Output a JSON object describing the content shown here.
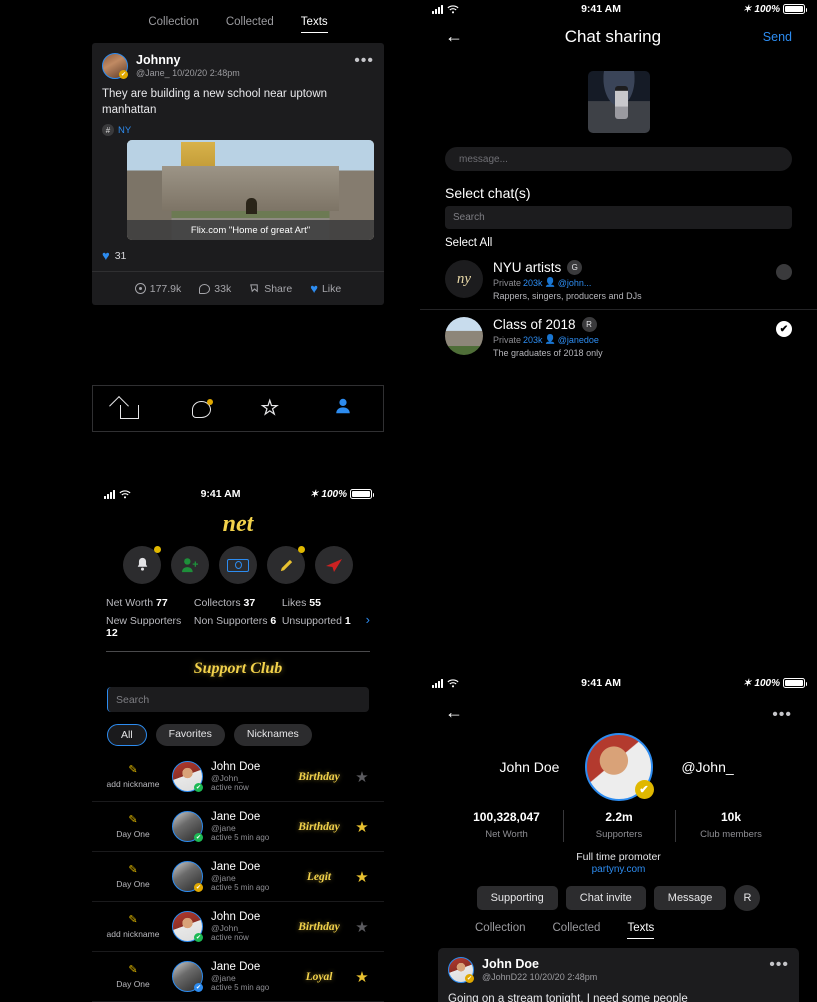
{
  "statusbar": {
    "time": "9:41 AM",
    "battery": "100%",
    "bt_icon": "bluetooth-icon"
  },
  "feed": {
    "tabs": [
      {
        "label": "Collection",
        "active": false
      },
      {
        "label": "Collected",
        "active": false
      },
      {
        "label": "Texts",
        "active": true
      }
    ],
    "post": {
      "author": "Johnny",
      "meta": "@Jane_ 10/20/20 2:48pm",
      "more": "•••",
      "text": "They are building a new school near uptown manhattan",
      "hash_symbol": "#",
      "tag": "NY",
      "photo_caption": "Flix.com \"Home of great Art\"",
      "likes_count": "31",
      "heart": "♥",
      "actions": [
        {
          "icon": "views-icon",
          "label": "177.9k"
        },
        {
          "icon": "comment-icon",
          "label": "33k"
        },
        {
          "icon": "share-icon",
          "label": "Share"
        },
        {
          "icon": "heart-icon",
          "label": "Like"
        }
      ]
    }
  },
  "tabbar": {
    "items": [
      {
        "name": "home-icon"
      },
      {
        "name": "messages-icon"
      },
      {
        "name": "star-icon"
      },
      {
        "name": "profile-icon"
      }
    ],
    "star_glyph": "☆",
    "person_glyph": "☰"
  },
  "net": {
    "brand": "net",
    "actions": [
      {
        "name": "bell-icon",
        "glyph": "🔔",
        "dot": true
      },
      {
        "name": "add-person-icon",
        "glyph": "👤",
        "dot": false
      },
      {
        "name": "money-icon",
        "glyph": "",
        "dot": false
      },
      {
        "name": "pencil-icon",
        "glyph": "✏",
        "dot": true
      },
      {
        "name": "send-icon",
        "glyph": "➤",
        "dot": false
      }
    ],
    "stats_top": [
      {
        "label": "Net Worth",
        "value": "77"
      },
      {
        "label": "Collectors",
        "value": "37"
      },
      {
        "label": "Likes",
        "value": "55"
      }
    ],
    "stats_bottom": [
      {
        "label": "New Supporters",
        "value": "12"
      },
      {
        "label": "Non Supporters",
        "value": "6"
      },
      {
        "label": "Unsupported",
        "value": "1"
      }
    ],
    "chevron": "›",
    "club_title": "Support Club",
    "search_placeholder": "Search",
    "chips": [
      {
        "label": "All",
        "active": true
      },
      {
        "label": "Favorites",
        "active": false
      },
      {
        "label": "Nicknames",
        "active": false
      }
    ],
    "users": [
      {
        "nickname": "add nickname",
        "name": "John Doe",
        "handle": "@John_",
        "active": "active now",
        "label": "Birthday",
        "star": "off",
        "avatar": "face",
        "badge": "green",
        "dot": true
      },
      {
        "nickname": "Day One",
        "name": "Jane Doe",
        "handle": "@jane",
        "active": "active 5 min ago",
        "label": "Birthday",
        "star": "on",
        "avatar": "dog",
        "badge": "green",
        "dot": false
      },
      {
        "nickname": "Day One",
        "name": "Jane Doe",
        "handle": "@jane",
        "active": "active 5 min ago",
        "label": "Legit",
        "star": "on",
        "avatar": "dog",
        "badge": "gold",
        "dot": false
      },
      {
        "nickname": "add nickname",
        "name": "John Doe",
        "handle": "@John_",
        "active": "active now",
        "label": "Birthday",
        "star": "off",
        "avatar": "face",
        "badge": "green",
        "dot": true
      },
      {
        "nickname": "Day One",
        "name": "Jane Doe",
        "handle": "@jane",
        "active": "active 5 min ago",
        "label": "Loyal",
        "star": "on",
        "avatar": "dog",
        "badge": "blueb",
        "dot": false
      }
    ]
  },
  "share": {
    "back": "←",
    "title": "Chat sharing",
    "send": "Send",
    "message_placeholder": "message...",
    "section_title": "Select chat(s)",
    "search_placeholder": "Search",
    "select_all": "Select All",
    "chats": [
      {
        "avatar": "ny-monogram",
        "monogram": "ny",
        "name": "NYU artists",
        "pill": "G",
        "privacy": "Private",
        "members": "203k",
        "owner": "@john...",
        "description": "Rappers, singers, producers and DJs",
        "selected": false
      },
      {
        "avatar": "campus-photo",
        "monogram": "",
        "name": "Class of 2018",
        "pill": "R",
        "privacy": "Private",
        "members": "203k",
        "owner": "@janedoe",
        "description": "The graduates of 2018 only",
        "selected": true
      }
    ],
    "check_glyph": "✔"
  },
  "profile": {
    "back": "←",
    "more": "•••",
    "name": "John Doe",
    "handle": "@John_",
    "verified_glyph": "✔",
    "stats": [
      {
        "value": "100,328,047",
        "label": "Net Worth"
      },
      {
        "value": "2.2m",
        "label": "Supporters"
      },
      {
        "value": "10k",
        "label": "Club members"
      }
    ],
    "bio": "Full time promoter",
    "website": "partyny.com",
    "buttons": [
      {
        "label": "Supporting"
      },
      {
        "label": "Chat invite"
      },
      {
        "label": "Message"
      }
    ],
    "round_button": "R",
    "tabs": [
      {
        "label": "Collection",
        "active": false
      },
      {
        "label": "Collected",
        "active": false
      },
      {
        "label": "Texts",
        "active": true
      }
    ],
    "post": {
      "author": "John Doe",
      "meta": "@JohnD22   10/20/20  2:48pm",
      "more": "•••",
      "text": "Going on a stream tonight. I need some people"
    }
  }
}
